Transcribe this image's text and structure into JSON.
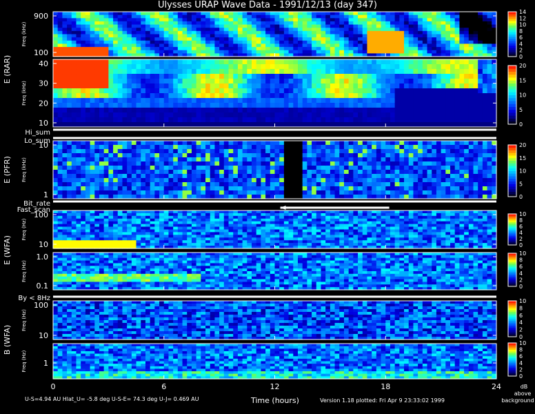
{
  "header": {
    "title": "Ulysses URAP Wave Data - 1991/12/13  (day 347)"
  },
  "footer": {
    "orbit_info": "U-S=4.94 AU  Hlat_U= -5.8 deg  U-S-E= 74.3 deg  U-J= 0.469 AU",
    "xlabel": "Time (hours)",
    "version": "Version 1.18 plotted: Fri Apr  9 23:33:02 1999",
    "units_line1": "dB",
    "units_line2": "above",
    "units_line3": "background"
  },
  "colors": {
    "background": "#000000",
    "axis": "#ffffff",
    "colormap": [
      "#000000",
      "#00007a",
      "#0000e0",
      "#0050ff",
      "#00a8ff",
      "#00ffff",
      "#60ff60",
      "#ffff00",
      "#ff8000",
      "#ff0000"
    ]
  },
  "chart_data": [
    {
      "type": "heatmap",
      "group_label": "E (RAR)",
      "ylabel": "Freq (kHz)",
      "y_scale": "log",
      "yticks": [
        "900",
        "100"
      ],
      "colorbar": {
        "ticks": [
          "0",
          "2",
          "4",
          "6",
          "8",
          "10",
          "12",
          "14"
        ],
        "range": [
          0,
          15
        ]
      },
      "x_range_hours": [
        0,
        24
      ]
    },
    {
      "type": "heatmap",
      "group_label": "E (RAR)",
      "ylabel": "Freq (kHz)",
      "y_scale": "linear",
      "yticks": [
        "40",
        "30",
        "20",
        "10"
      ],
      "colorbar": {
        "ticks": [
          "0",
          "5",
          "10",
          "15",
          "20"
        ],
        "range": [
          0,
          20
        ]
      },
      "x_range_hours": [
        0,
        24
      ]
    },
    {
      "type": "heatmap",
      "group_label": "E (PFR)",
      "ylabel": "Freq (kHz)",
      "y_scale": "log",
      "yticks": [
        "10",
        "1"
      ],
      "colorbar": {
        "ticks": [
          "0",
          "5",
          "10",
          "15",
          "20"
        ],
        "range": [
          0,
          20
        ]
      },
      "x_range_hours": [
        0,
        24
      ],
      "data_gap_hours": [
        12.5,
        13.6
      ]
    },
    {
      "type": "heatmap",
      "group_label": "E (WFA)",
      "ylabel": "Freq (Hz)",
      "y_scale": "log",
      "yticks": [
        "100",
        "10"
      ],
      "colorbar": {
        "ticks": [
          "0",
          "2",
          "4",
          "6",
          "8",
          "10"
        ],
        "range": [
          0,
          10
        ]
      },
      "x_range_hours": [
        0,
        24
      ]
    },
    {
      "type": "heatmap",
      "group_label": "E (WFA)",
      "ylabel": "Freq (Hz)",
      "y_scale": "log",
      "yticks": [
        "1.0",
        "0.1"
      ],
      "colorbar": {
        "ticks": [
          "0",
          "2",
          "4",
          "6",
          "8",
          "10"
        ],
        "range": [
          0,
          10
        ]
      },
      "x_range_hours": [
        0,
        24
      ]
    },
    {
      "type": "heatmap",
      "group_label": "B (WFA)",
      "ylabel": "Freq (Hz)",
      "y_scale": "log",
      "yticks": [
        "100",
        "10"
      ],
      "colorbar": {
        "ticks": [
          "0",
          "2",
          "4",
          "6",
          "8",
          "10"
        ],
        "range": [
          0,
          10
        ]
      },
      "x_range_hours": [
        0,
        24
      ]
    },
    {
      "type": "heatmap",
      "group_label": "B (WFA)",
      "ylabel": "Freq (Hz)",
      "y_scale": "log",
      "yticks": [
        "1"
      ],
      "colorbar": {
        "ticks": [
          "0",
          "2",
          "4",
          "6",
          "8",
          "10"
        ],
        "range": [
          0,
          10
        ]
      },
      "x_range_hours": [
        0,
        24
      ]
    }
  ],
  "strips": [
    {
      "label": "Hi_sum"
    },
    {
      "label": "Lo_sum"
    },
    {
      "label": "Bit_rate"
    },
    {
      "label": "Fast_scan"
    },
    {
      "label": "By < 8Hz"
    }
  ],
  "x_axis": {
    "range_hours": [
      0,
      24
    ],
    "ticks": [
      "0",
      "6",
      "12",
      "18",
      "24"
    ]
  }
}
